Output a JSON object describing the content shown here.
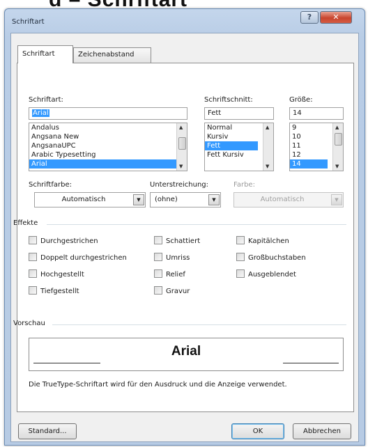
{
  "banner": {
    "text": "d – Schriftart"
  },
  "window": {
    "title": "Schriftart",
    "help_glyph": "?",
    "close_glyph": "✕"
  },
  "tabs": [
    {
      "label": "Schriftart",
      "active": true
    },
    {
      "label": "Zeichenabstand",
      "active": false
    }
  ],
  "font": {
    "label": "Schriftart:",
    "value": "Arial",
    "items": [
      "Andalus",
      "Angsana New",
      "AngsanaUPC",
      "Arabic Typesetting",
      "Arial"
    ],
    "selected": "Arial"
  },
  "style": {
    "label": "Schriftschnitt:",
    "value": "Fett",
    "items": [
      "Normal",
      "Kursiv",
      "Fett",
      "Fett Kursiv"
    ],
    "selected": "Fett"
  },
  "size": {
    "label": "Größe:",
    "value": "14",
    "items": [
      "9",
      "10",
      "11",
      "12",
      "14"
    ],
    "selected": "14"
  },
  "color": {
    "label": "Schriftfarbe:",
    "value": "Automatisch"
  },
  "underline": {
    "label": "Unterstreichung:",
    "value": "(ohne)"
  },
  "underline_color": {
    "label": "Farbe:",
    "value": "Automatisch",
    "enabled": false
  },
  "effects": {
    "title": "Effekte",
    "items": [
      {
        "label": "Durchgestrichen",
        "checked": false
      },
      {
        "label": "Doppelt durchgestrichen",
        "checked": false
      },
      {
        "label": "Hochgestellt",
        "checked": false
      },
      {
        "label": "Tiefgestellt",
        "checked": false
      },
      {
        "label": "Schattiert",
        "checked": false
      },
      {
        "label": "Umriss",
        "checked": false
      },
      {
        "label": "Relief",
        "checked": false
      },
      {
        "label": "Gravur",
        "checked": false
      },
      {
        "label": "Kapitälchen",
        "checked": false
      },
      {
        "label": "Großbuchstaben",
        "checked": false
      },
      {
        "label": "Ausgeblendet",
        "checked": false
      }
    ]
  },
  "preview": {
    "title": "Vorschau",
    "sample": "Arial",
    "description": "Die TrueType-Schriftart wird für den Ausdruck und die Anzeige verwendet."
  },
  "buttons": {
    "standard": "Standard...",
    "ok": "OK",
    "cancel": "Abbrechen"
  },
  "icons": {
    "scroll_up": "▲",
    "scroll_down": "▼",
    "dropdown": "▼"
  }
}
